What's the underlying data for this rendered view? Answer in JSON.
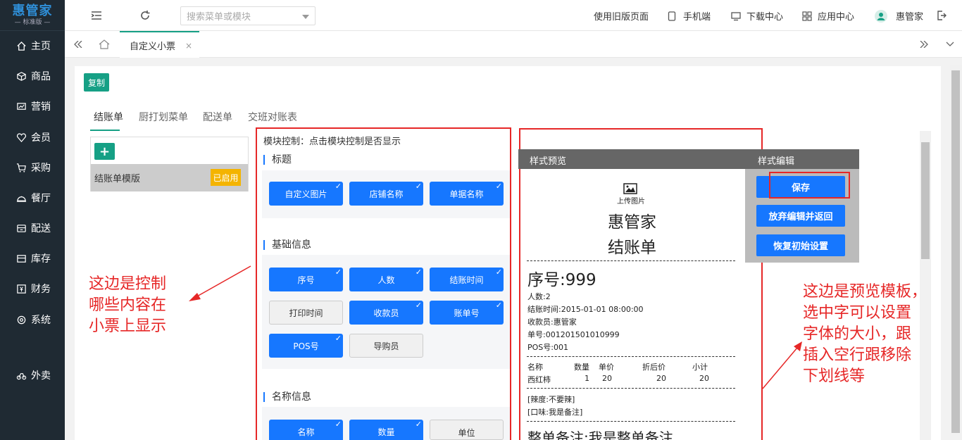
{
  "sidebar": {
    "logo": "惠管家",
    "logo_sub": "— 标准版 —",
    "items": [
      {
        "label": "主页",
        "icon": "home-icon"
      },
      {
        "label": "商品",
        "icon": "box-icon"
      },
      {
        "label": "营销",
        "icon": "chart-icon"
      },
      {
        "label": "会员",
        "icon": "heart-icon"
      },
      {
        "label": "采购",
        "icon": "cart-icon"
      },
      {
        "label": "餐厅",
        "icon": "restaurant-icon"
      },
      {
        "label": "配送",
        "icon": "delivery-icon"
      },
      {
        "label": "库存",
        "icon": "inventory-icon"
      },
      {
        "label": "财务",
        "icon": "finance-icon"
      },
      {
        "label": "系统",
        "icon": "gear-icon"
      },
      {
        "label": "外卖",
        "icon": "bike-icon"
      }
    ]
  },
  "header": {
    "search_placeholder": "搜索菜单或模块",
    "old_version": "使用旧版页面",
    "mobile": "手机端",
    "download": "下载中心",
    "apps": "应用中心",
    "user": "惠管家"
  },
  "tabs": {
    "active": "自定义小票",
    "close": "×"
  },
  "content": {
    "copy_label": "复制",
    "subtabs": [
      "结账单",
      "厨打划菜单",
      "配送单",
      "交班对账表"
    ],
    "add_label": "+",
    "template_name": "结账单模版",
    "template_status": "已启用",
    "module_title": "模块控制：点击模块控制是否显示",
    "sections": {
      "title": {
        "label": "标题",
        "buttons": [
          {
            "label": "自定义图片",
            "on": true
          },
          {
            "label": "店铺名称",
            "on": true
          },
          {
            "label": "单据名称",
            "on": true
          }
        ]
      },
      "basic": {
        "label": "基础信息",
        "buttons": [
          {
            "label": "序号",
            "on": true
          },
          {
            "label": "人数",
            "on": true
          },
          {
            "label": "结账时间",
            "on": true
          },
          {
            "label": "打印时间",
            "on": false
          },
          {
            "label": "收款员",
            "on": true
          },
          {
            "label": "账单号",
            "on": true
          },
          {
            "label": "POS号",
            "on": true
          },
          {
            "label": "导购员",
            "on": false
          }
        ]
      },
      "names": {
        "label": "名称信息",
        "buttons": [
          {
            "label": "名称",
            "on": true
          },
          {
            "label": "数量",
            "on": true
          },
          {
            "label": "单位",
            "on": false
          }
        ]
      }
    },
    "check_mark": "✓"
  },
  "preview": {
    "head_left": "样式预览",
    "head_right": "样式编辑",
    "upload": "上传图片",
    "store_name": "惠管家",
    "doc_name": "结账单",
    "serial": "序号:999",
    "people": "人数:2",
    "checkout_time": "结账时间:2015-01-01 08:00:00",
    "cashier": "收款员:惠管家",
    "bill_no": "单号:001201501010999",
    "pos_no": "POS号:001",
    "table_head": [
      "名称",
      "数量",
      "单价",
      "折后价",
      "小计"
    ],
    "table_row": [
      "西红柿",
      "1",
      "20",
      "20",
      "20"
    ],
    "spicy": "[辣度:不要辣]",
    "taste": "[口味:我是备注]",
    "remark": "整单备注:我是整单备注"
  },
  "edit": {
    "save": "保存",
    "discard": "放弃编辑并返回",
    "reset": "恢复初始设置"
  },
  "annotations": {
    "left": [
      "这边是控制",
      "哪些内容在",
      "小票上显示"
    ],
    "right": [
      "这边是预览模板，",
      "选中字可以设置",
      "字体的大小，跟",
      "插入空行跟移除",
      "下划线等"
    ]
  },
  "colors": {
    "accent": "#16a085",
    "primary": "#1677ff",
    "sidebar": "#1f2a33",
    "highlight": "#e62727",
    "badge": "#f4b400"
  }
}
